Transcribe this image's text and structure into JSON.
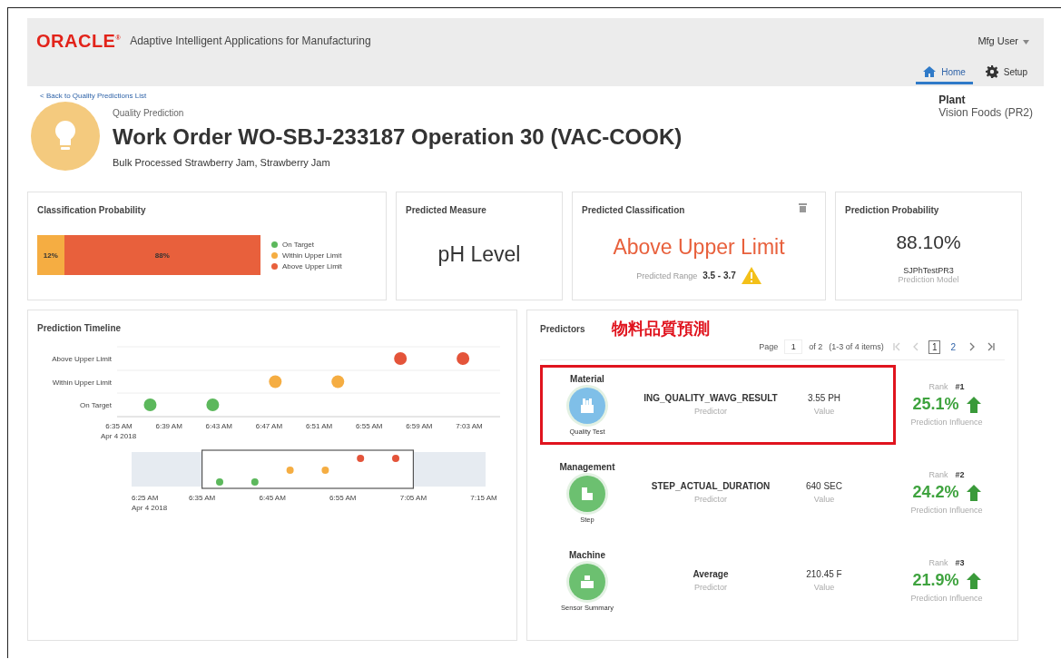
{
  "header": {
    "brand": "ORACLE$^{®}$",
    "app_title": "Adaptive Intelligent Applications for Manufacturing",
    "user_menu": "Mfg User",
    "tabs": [
      {
        "label": "Home",
        "selected": true
      },
      {
        "label": "Setup",
        "selected": false
      }
    ]
  },
  "back_link": "< Back to Quality Predictions List",
  "plant": {
    "label": "Plant",
    "value": "Vision Foods (PR2)"
  },
  "page_header": {
    "overline": "Quality Prediction",
    "title": "Work Order WO-SBJ-233187 Operation 30 (VAC-COOK)",
    "subtitle": "Bulk Processed Strawberry Jam, Strawberry Jam"
  },
  "classification_probability": {
    "title": "Classification Probability",
    "segments": [
      {
        "label": "12%",
        "color": "#f5ad42"
      },
      {
        "label": "88%",
        "color": "#e8603c"
      }
    ],
    "legend": [
      {
        "label": "On Target",
        "color": "#5cb85c"
      },
      {
        "label": "Within Upper Limit",
        "color": "#f5ad42"
      },
      {
        "label": "Above Upper Limit",
        "color": "#e8603c"
      }
    ]
  },
  "predicted_measure": {
    "title": "Predicted Measure",
    "value": "pH Level"
  },
  "predicted_classification": {
    "title": "Predicted Classification",
    "value": "Above Upper Limit",
    "range_label": "Predicted Range",
    "range_value": "3.5 - 3.7",
    "warning": true
  },
  "prediction_probability": {
    "title": "Prediction Probability",
    "value": "88.10%",
    "model": "SJPhTestPR3",
    "model_label": "Prediction Model"
  },
  "prediction_timeline": {
    "title": "Prediction Timeline",
    "date_label": "Apr 4 2018",
    "rows": [
      {
        "kind": "above",
        "label": "Above Upper Limit",
        "color": "#e4543a"
      },
      {
        "kind": "within",
        "label": "Within Upper Limit",
        "color": "#f5ad42"
      },
      {
        "kind": "on_target",
        "label": "On Target",
        "color": "#5cb85c"
      }
    ],
    "points": [
      {
        "kind": "on_target"
      },
      {
        "kind": "on_target"
      },
      {
        "kind": "within"
      },
      {
        "kind": "within"
      },
      {
        "kind": "above"
      },
      {
        "kind": "above"
      }
    ],
    "ticks": [
      "6:35 AM",
      "6:39 AM",
      "6:43 AM",
      "6:47 AM",
      "6:51 AM",
      "6:55 AM",
      "6:59 AM",
      "7:03 AM"
    ],
    "overview": {
      "ticks": [
        "6:25 AM",
        "6:35 AM",
        "6:45 AM",
        "6:55 AM",
        "7:05 AM",
        "7:15 AM"
      ],
      "date_label": "Apr 4 2018"
    }
  },
  "predictors": {
    "title": "Predictors",
    "annotation": "物料品質預測",
    "pager": {
      "page_label": "Page",
      "page_value": "1",
      "of_text": "of 2",
      "range_text": "(1-3 of 4 items)",
      "nav": [
        {
          "kind": "first",
          "disabled": true
        },
        {
          "kind": "prev",
          "disabled": true
        },
        {
          "kind": "page",
          "label": "1",
          "selected": true
        },
        {
          "kind": "page",
          "label": "2",
          "selected": false
        },
        {
          "kind": "next",
          "disabled": false
        },
        {
          "kind": "last",
          "disabled": false
        }
      ]
    },
    "items": [
      {
        "category": "Material",
        "color": "#7fbfe8",
        "caption": "Quality Test",
        "name": "ING_QUALITY_WAVG_RESULT",
        "name_label": "Predictor",
        "value": "3.55 PH",
        "value_label": "Value",
        "rank_label": "Rank",
        "rank": "#1",
        "influence": "25.1%",
        "influence_label": "Prediction Influence",
        "highlighted": true
      },
      {
        "category": "Management",
        "color": "#6cc070",
        "caption": "Step",
        "name": "STEP_ACTUAL_DURATION",
        "name_label": "Predictor",
        "value": "640 SEC",
        "value_label": "Value",
        "rank_label": "Rank",
        "rank": "#2",
        "influence": "24.2%",
        "influence_label": "Prediction Influence",
        "highlighted": false
      },
      {
        "category": "Machine",
        "color": "#6cc070",
        "caption": "Sensor Summary",
        "name": "Average",
        "name_label": "Predictor",
        "value": "210.45 F",
        "value_label": "Value",
        "rank_label": "Rank",
        "rank": "#3",
        "influence": "21.9%",
        "influence_label": "Prediction Influence",
        "highlighted": false
      }
    ]
  }
}
